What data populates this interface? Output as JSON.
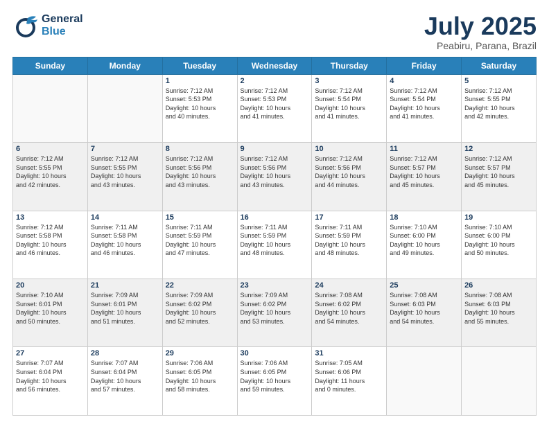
{
  "header": {
    "logo_line1": "General",
    "logo_line2": "Blue",
    "title": "July 2025",
    "subtitle": "Peabiru, Parana, Brazil"
  },
  "days_of_week": [
    "Sunday",
    "Monday",
    "Tuesday",
    "Wednesday",
    "Thursday",
    "Friday",
    "Saturday"
  ],
  "weeks": [
    [
      {
        "day": "",
        "info": ""
      },
      {
        "day": "",
        "info": ""
      },
      {
        "day": "1",
        "info": "Sunrise: 7:12 AM\nSunset: 5:53 PM\nDaylight: 10 hours\nand 40 minutes."
      },
      {
        "day": "2",
        "info": "Sunrise: 7:12 AM\nSunset: 5:53 PM\nDaylight: 10 hours\nand 41 minutes."
      },
      {
        "day": "3",
        "info": "Sunrise: 7:12 AM\nSunset: 5:54 PM\nDaylight: 10 hours\nand 41 minutes."
      },
      {
        "day": "4",
        "info": "Sunrise: 7:12 AM\nSunset: 5:54 PM\nDaylight: 10 hours\nand 41 minutes."
      },
      {
        "day": "5",
        "info": "Sunrise: 7:12 AM\nSunset: 5:55 PM\nDaylight: 10 hours\nand 42 minutes."
      }
    ],
    [
      {
        "day": "6",
        "info": "Sunrise: 7:12 AM\nSunset: 5:55 PM\nDaylight: 10 hours\nand 42 minutes."
      },
      {
        "day": "7",
        "info": "Sunrise: 7:12 AM\nSunset: 5:55 PM\nDaylight: 10 hours\nand 43 minutes."
      },
      {
        "day": "8",
        "info": "Sunrise: 7:12 AM\nSunset: 5:56 PM\nDaylight: 10 hours\nand 43 minutes."
      },
      {
        "day": "9",
        "info": "Sunrise: 7:12 AM\nSunset: 5:56 PM\nDaylight: 10 hours\nand 43 minutes."
      },
      {
        "day": "10",
        "info": "Sunrise: 7:12 AM\nSunset: 5:56 PM\nDaylight: 10 hours\nand 44 minutes."
      },
      {
        "day": "11",
        "info": "Sunrise: 7:12 AM\nSunset: 5:57 PM\nDaylight: 10 hours\nand 45 minutes."
      },
      {
        "day": "12",
        "info": "Sunrise: 7:12 AM\nSunset: 5:57 PM\nDaylight: 10 hours\nand 45 minutes."
      }
    ],
    [
      {
        "day": "13",
        "info": "Sunrise: 7:12 AM\nSunset: 5:58 PM\nDaylight: 10 hours\nand 46 minutes."
      },
      {
        "day": "14",
        "info": "Sunrise: 7:11 AM\nSunset: 5:58 PM\nDaylight: 10 hours\nand 46 minutes."
      },
      {
        "day": "15",
        "info": "Sunrise: 7:11 AM\nSunset: 5:59 PM\nDaylight: 10 hours\nand 47 minutes."
      },
      {
        "day": "16",
        "info": "Sunrise: 7:11 AM\nSunset: 5:59 PM\nDaylight: 10 hours\nand 48 minutes."
      },
      {
        "day": "17",
        "info": "Sunrise: 7:11 AM\nSunset: 5:59 PM\nDaylight: 10 hours\nand 48 minutes."
      },
      {
        "day": "18",
        "info": "Sunrise: 7:10 AM\nSunset: 6:00 PM\nDaylight: 10 hours\nand 49 minutes."
      },
      {
        "day": "19",
        "info": "Sunrise: 7:10 AM\nSunset: 6:00 PM\nDaylight: 10 hours\nand 50 minutes."
      }
    ],
    [
      {
        "day": "20",
        "info": "Sunrise: 7:10 AM\nSunset: 6:01 PM\nDaylight: 10 hours\nand 50 minutes."
      },
      {
        "day": "21",
        "info": "Sunrise: 7:09 AM\nSunset: 6:01 PM\nDaylight: 10 hours\nand 51 minutes."
      },
      {
        "day": "22",
        "info": "Sunrise: 7:09 AM\nSunset: 6:02 PM\nDaylight: 10 hours\nand 52 minutes."
      },
      {
        "day": "23",
        "info": "Sunrise: 7:09 AM\nSunset: 6:02 PM\nDaylight: 10 hours\nand 53 minutes."
      },
      {
        "day": "24",
        "info": "Sunrise: 7:08 AM\nSunset: 6:02 PM\nDaylight: 10 hours\nand 54 minutes."
      },
      {
        "day": "25",
        "info": "Sunrise: 7:08 AM\nSunset: 6:03 PM\nDaylight: 10 hours\nand 54 minutes."
      },
      {
        "day": "26",
        "info": "Sunrise: 7:08 AM\nSunset: 6:03 PM\nDaylight: 10 hours\nand 55 minutes."
      }
    ],
    [
      {
        "day": "27",
        "info": "Sunrise: 7:07 AM\nSunset: 6:04 PM\nDaylight: 10 hours\nand 56 minutes."
      },
      {
        "day": "28",
        "info": "Sunrise: 7:07 AM\nSunset: 6:04 PM\nDaylight: 10 hours\nand 57 minutes."
      },
      {
        "day": "29",
        "info": "Sunrise: 7:06 AM\nSunset: 6:05 PM\nDaylight: 10 hours\nand 58 minutes."
      },
      {
        "day": "30",
        "info": "Sunrise: 7:06 AM\nSunset: 6:05 PM\nDaylight: 10 hours\nand 59 minutes."
      },
      {
        "day": "31",
        "info": "Sunrise: 7:05 AM\nSunset: 6:06 PM\nDaylight: 11 hours\nand 0 minutes."
      },
      {
        "day": "",
        "info": ""
      },
      {
        "day": "",
        "info": ""
      }
    ]
  ]
}
